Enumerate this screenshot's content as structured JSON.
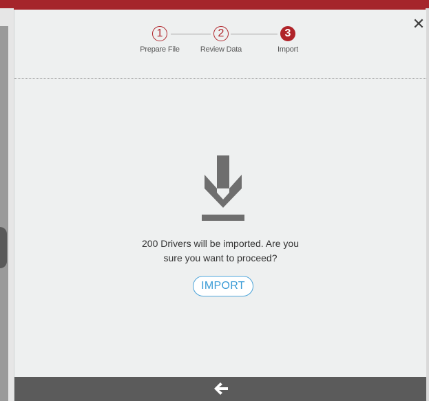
{
  "dialog": {
    "close_label": "✕"
  },
  "stepper": {
    "steps": [
      {
        "number": "1",
        "label": "Prepare File",
        "state": "completed"
      },
      {
        "number": "2",
        "label": "Review Data",
        "state": "completed"
      },
      {
        "number": "3",
        "label": "Import",
        "state": "active"
      }
    ]
  },
  "content": {
    "icon": "download-icon",
    "message_line1": "200 Drivers will be imported. Are you",
    "message_line2": "sure you want to proceed?",
    "import_label": "IMPORT"
  },
  "footer": {
    "back_icon": "arrow-left-icon"
  },
  "colors": {
    "accent_red": "#b0242a",
    "link_blue": "#3a9bd6",
    "footer_gray": "#5b5b5b"
  }
}
